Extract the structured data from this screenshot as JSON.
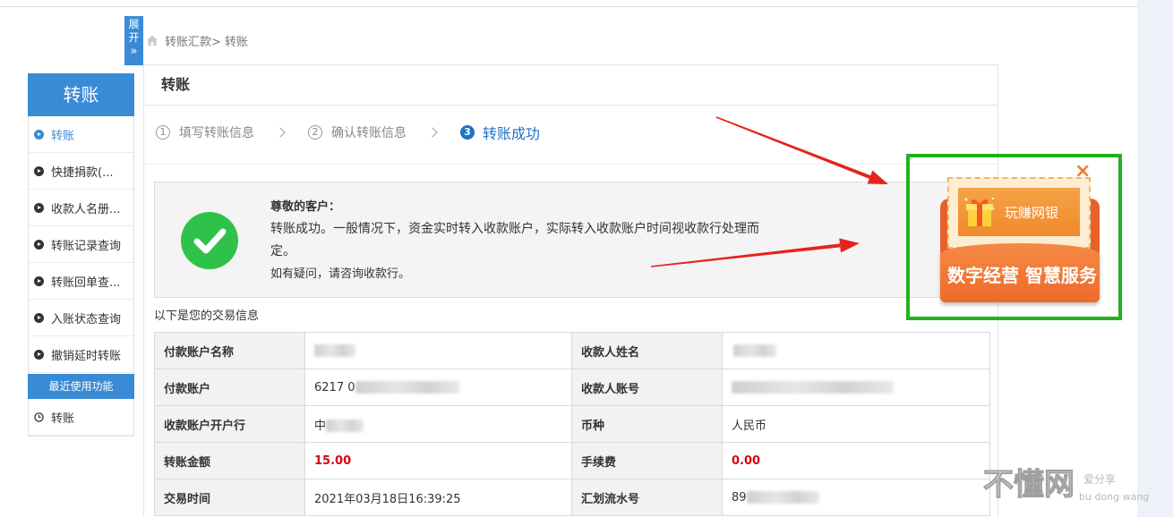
{
  "colors": {
    "accent": "#3a8bd6",
    "step_active": "#1f72c4",
    "success": "#2fc24a",
    "amount": "#d7000f",
    "annotation_box": "#23b21c",
    "arrow": "#e5231d",
    "ad_orange": "#f07a31"
  },
  "expand_tab": {
    "label": "展开",
    "chevron": "»"
  },
  "breadcrumb": {
    "icon": "home-icon",
    "text": "转账汇款> 转账"
  },
  "sidebar": {
    "title": "转账",
    "items": [
      {
        "label": "转账",
        "icon": "circle-play-icon",
        "active": true
      },
      {
        "label": "快捷捐款(...",
        "icon": "circle-play-icon"
      },
      {
        "label": "收款人名册...",
        "icon": "circle-play-icon"
      },
      {
        "label": "转账记录查询",
        "icon": "circle-play-icon"
      },
      {
        "label": "转账回单查...",
        "icon": "circle-play-icon"
      },
      {
        "label": "入账状态查询",
        "icon": "circle-play-icon"
      },
      {
        "label": "撤销延时转账",
        "icon": "circle-play-icon"
      }
    ],
    "recent_title": "最近使用功能",
    "recent_items": [
      {
        "label": "转账",
        "icon": "clock-icon"
      }
    ]
  },
  "panel": {
    "title": "转账",
    "steps": [
      {
        "number": "1",
        "label": "填写转账信息"
      },
      {
        "number": "2",
        "label": "确认转账信息"
      },
      {
        "number": "3",
        "label": "转账成功",
        "active": true
      }
    ]
  },
  "result": {
    "icon": "success-check-icon",
    "greeting": "尊敬的客户：",
    "message": "转账成功。一般情况下，资金实时转入收款账户，实际转入收款账户时间视收款行处理而定。",
    "note": "如有疑问，请咨询收款行。"
  },
  "transaction": {
    "caption": "以下是您的交易信息",
    "rows": [
      {
        "label_1": "付款账户名称",
        "label_2": "收款人姓名"
      },
      {
        "label_1": "付款账户",
        "value_1": "6217 0",
        "label_2": "收款人账号"
      },
      {
        "label_1": "收款账户开户行",
        "value_1": "中",
        "label_2": "币种",
        "value_2": "人民币"
      },
      {
        "label_1": "转账金额",
        "value_1": "15.00",
        "label_2": "手续费",
        "value_2": "0.00"
      },
      {
        "label_1": "交易时间",
        "value_1": "2021年03月18日16:39:25",
        "label_2": "汇划流水号",
        "value_2": "89"
      }
    ]
  },
  "ad": {
    "icon": "gift-icon",
    "badge": "玩赚网银",
    "slogan": "数字经营 智慧服务",
    "close": "×"
  },
  "watermark": {
    "main": "不懂网",
    "sub": "爱分享",
    "pinyin": "bu dong wang"
  }
}
